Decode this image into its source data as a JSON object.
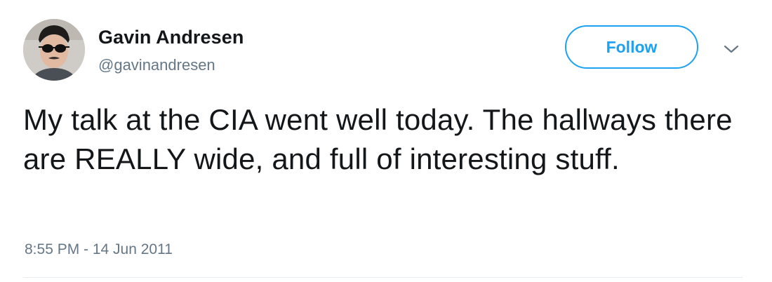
{
  "user": {
    "name": "Gavin Andresen",
    "handle": "@gavinandresen",
    "avatar_icon": "user-avatar-photo"
  },
  "actions": {
    "follow_label": "Follow",
    "more_icon": "chevron-down-icon"
  },
  "tweet": {
    "text": "My talk at the CIA went well today. The hallways there are REALLY wide, and full of interesting stuff.",
    "timestamp": "8:55 PM - 14 Jun 2011"
  },
  "colors": {
    "accent": "#1da1f2",
    "text": "#14171a",
    "secondary": "#657786"
  }
}
